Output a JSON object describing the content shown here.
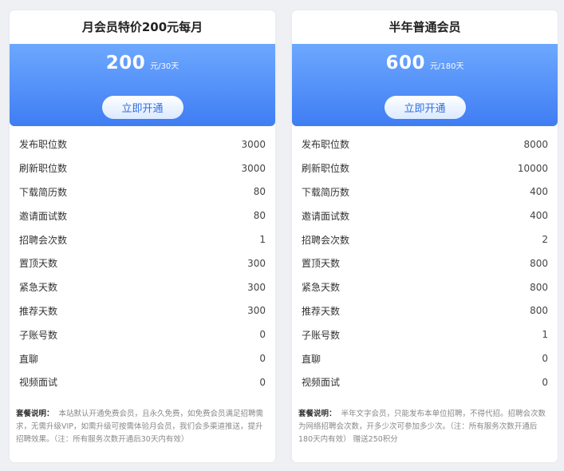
{
  "plans": [
    {
      "title": "月会员特价200元每月",
      "price": "200",
      "unit": "元/30天",
      "button": "立即开通",
      "rows": [
        {
          "label": "发布职位数",
          "value": "3000"
        },
        {
          "label": "刷新职位数",
          "value": "3000"
        },
        {
          "label": "下载简历数",
          "value": "80"
        },
        {
          "label": "邀请面试数",
          "value": "80"
        },
        {
          "label": "招聘会次数",
          "value": "1"
        },
        {
          "label": "置顶天数",
          "value": "300"
        },
        {
          "label": "紧急天数",
          "value": "300"
        },
        {
          "label": "推荐天数",
          "value": "300"
        },
        {
          "label": "子账号数",
          "value": "0"
        },
        {
          "label": "直聊",
          "value": "0"
        },
        {
          "label": "视频面试",
          "value": "0"
        }
      ],
      "note_label": "套餐说明：",
      "note_text": "本站默认开通免费会员，且永久免费，如免费会员满足招聘需求，无需升级VIP，如需升级可按需体验月会员，我们会多渠道推送，提升招聘效果。（注：所有服务次数开通后30天内有效）"
    },
    {
      "title": "半年普通会员",
      "price": "600",
      "unit": "元/180天",
      "button": "立即开通",
      "rows": [
        {
          "label": "发布职位数",
          "value": "8000"
        },
        {
          "label": "刷新职位数",
          "value": "10000"
        },
        {
          "label": "下载简历数",
          "value": "400"
        },
        {
          "label": "邀请面试数",
          "value": "400"
        },
        {
          "label": "招聘会次数",
          "value": "2"
        },
        {
          "label": "置顶天数",
          "value": "800"
        },
        {
          "label": "紧急天数",
          "value": "800"
        },
        {
          "label": "推荐天数",
          "value": "800"
        },
        {
          "label": "子账号数",
          "value": "1"
        },
        {
          "label": "直聊",
          "value": "0"
        },
        {
          "label": "视频面试",
          "value": "0"
        }
      ],
      "note_label": "套餐说明：",
      "note_text": "半年文字会员，只能发布本单位招聘，不得代招。招聘会次数为网络招聘会次数，开多少次可参加多少次。（注：所有服务次数开通后180天内有效） 赠送250积分"
    }
  ]
}
